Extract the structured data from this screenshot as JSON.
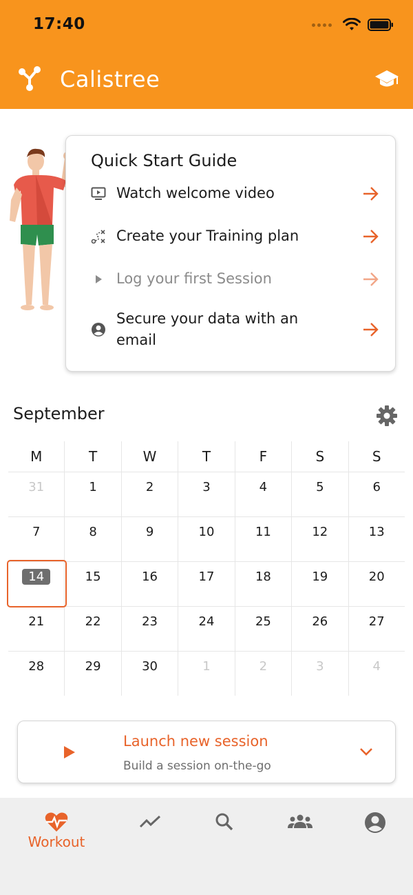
{
  "status_bar": {
    "time": "17:40"
  },
  "header": {
    "title": "Calistree",
    "logo_icon": "tree-branch-icon",
    "action_icon": "graduation-cap-icon"
  },
  "quick_start": {
    "title": "Quick Start Guide",
    "items": [
      {
        "label": "Watch welcome video",
        "icon": "video-icon",
        "enabled": true
      },
      {
        "label": "Create your Training plan",
        "icon": "route-icon",
        "enabled": true
      },
      {
        "label": "Log your first Session",
        "icon": "play-icon",
        "enabled": false
      },
      {
        "label": "Secure your data with an email",
        "icon": "account-icon",
        "enabled": true
      }
    ]
  },
  "calendar": {
    "month": "September",
    "weekdays": [
      "M",
      "T",
      "W",
      "T",
      "F",
      "S",
      "S"
    ],
    "weeks": [
      [
        "31",
        "1",
        "2",
        "3",
        "4",
        "5",
        "6"
      ],
      [
        "7",
        "8",
        "9",
        "10",
        "11",
        "12",
        "13"
      ],
      [
        "14",
        "15",
        "16",
        "17",
        "18",
        "19",
        "20"
      ],
      [
        "21",
        "22",
        "23",
        "24",
        "25",
        "26",
        "27"
      ],
      [
        "28",
        "29",
        "30",
        "1",
        "2",
        "3",
        "4"
      ]
    ],
    "today": "14"
  },
  "launch": {
    "title": "Launch new session",
    "subtitle": "Build a session on-the-go"
  },
  "bottom_nav": {
    "items": [
      {
        "label": "Workout",
        "icon": "heart-pulse-icon",
        "active": true
      },
      {
        "label": "",
        "icon": "trend-icon",
        "active": false
      },
      {
        "label": "",
        "icon": "search-icon",
        "active": false
      },
      {
        "label": "",
        "icon": "community-icon",
        "active": false
      },
      {
        "label": "",
        "icon": "profile-icon",
        "active": false
      }
    ]
  },
  "colors": {
    "brand": "#F8941D",
    "accent": "#E8632A"
  }
}
